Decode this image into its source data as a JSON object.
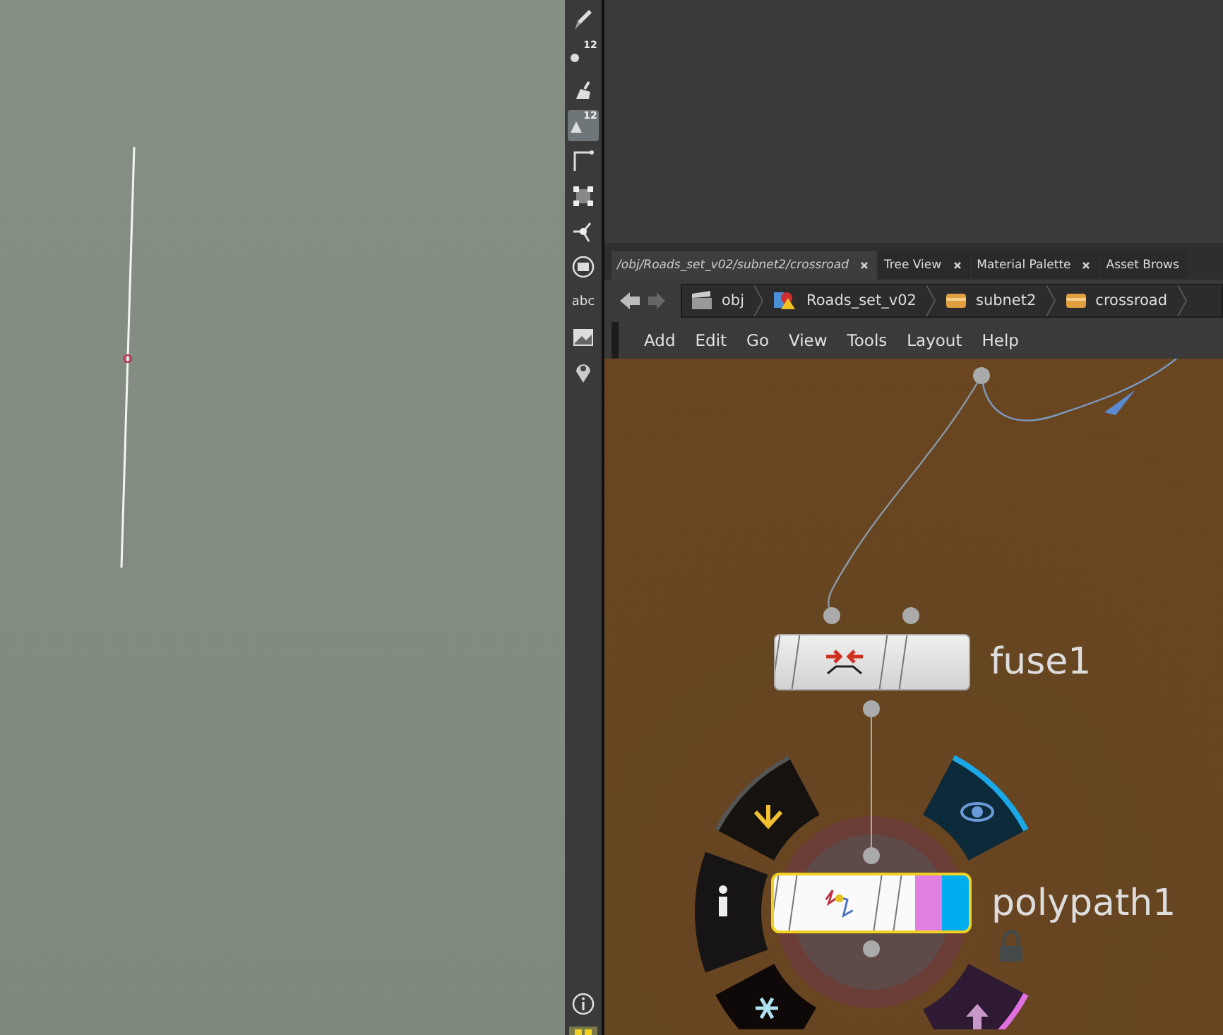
{
  "toolbar": {
    "tools": [
      {
        "kind": "pen",
        "selected": false
      },
      {
        "kind": "numbered-point",
        "label": "12",
        "selected": false
      },
      {
        "kind": "brush",
        "selected": false
      },
      {
        "kind": "numbered-brush",
        "label": "12",
        "selected": true
      },
      {
        "kind": "corner",
        "selected": false
      },
      {
        "kind": "box",
        "selected": false
      },
      {
        "kind": "handle",
        "selected": false
      },
      {
        "kind": "circle",
        "selected": false
      },
      {
        "kind": "text",
        "label": "abc",
        "selected": false
      },
      {
        "kind": "image",
        "selected": false
      },
      {
        "kind": "pin",
        "selected": false
      }
    ]
  },
  "tabs": [
    {
      "label": "/obj/Roads_set_v02/subnet2/crossroad",
      "selected": true
    },
    {
      "label": "Tree View",
      "selected": false
    },
    {
      "label": "Material Palette",
      "selected": false
    },
    {
      "label": "Asset Brows",
      "selected": false
    }
  ],
  "path_bar": [
    {
      "kind": "obj",
      "label": "obj"
    },
    {
      "kind": "asset",
      "label": "Roads_set_v02"
    },
    {
      "kind": "subnet",
      "label": "subnet2"
    },
    {
      "kind": "subnet",
      "label": "crossroad"
    }
  ],
  "menu": [
    "Add",
    "Edit",
    "Go",
    "View",
    "Tools",
    "Layout",
    "Help"
  ],
  "nodes": [
    {
      "name": "fuse1",
      "selected": false,
      "display": false,
      "template": false
    },
    {
      "name": "polypath1",
      "selected": true,
      "display": true,
      "template": true
    }
  ]
}
